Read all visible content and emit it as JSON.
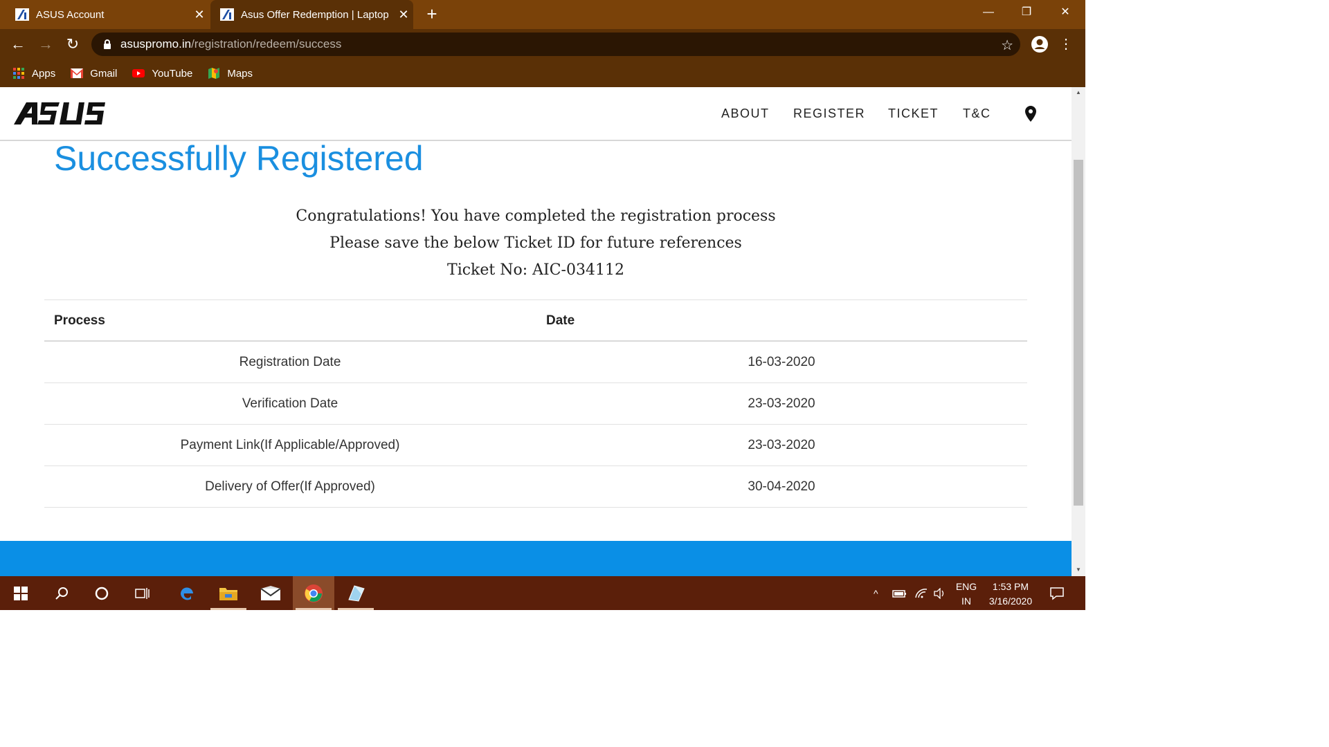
{
  "browser": {
    "tabs": [
      {
        "title": "ASUS Account",
        "close": "✕"
      },
      {
        "title": "Asus Offer Redemption | Laptop",
        "close": "✕"
      }
    ],
    "new_tab": "+",
    "url_domain": "asuspromo.in",
    "url_path": "/registration/redeem/success",
    "bookmarks": [
      "Apps",
      "Gmail",
      "YouTube",
      "Maps"
    ]
  },
  "site": {
    "nav": [
      "ABOUT",
      "REGISTER",
      "TICKET",
      "T&C"
    ],
    "title": "Successfully Registered",
    "messages": [
      "Congratulations! You have completed the registration process",
      "Please save the below Ticket ID for future references",
      "Ticket No: AIC-034112"
    ],
    "table": {
      "headers": [
        "Process",
        "Date"
      ],
      "rows": [
        {
          "process": "Registration Date",
          "date": "16-03-2020"
        },
        {
          "process": "Verification Date",
          "date": "23-03-2020"
        },
        {
          "process": "Payment Link(If Applicable/Approved)",
          "date": "23-03-2020"
        },
        {
          "process": "Delivery of Offer(If Approved)",
          "date": "30-04-2020"
        }
      ]
    }
  },
  "taskbar": {
    "lang": [
      "ENG",
      "IN"
    ],
    "time": "1:53 PM",
    "date": "3/16/2020"
  },
  "colors": {
    "accent": "#1a8fe0",
    "footer": "#0a8fe6",
    "chrome_frame": "#7a4209",
    "taskbar": "#5b1f0a"
  }
}
